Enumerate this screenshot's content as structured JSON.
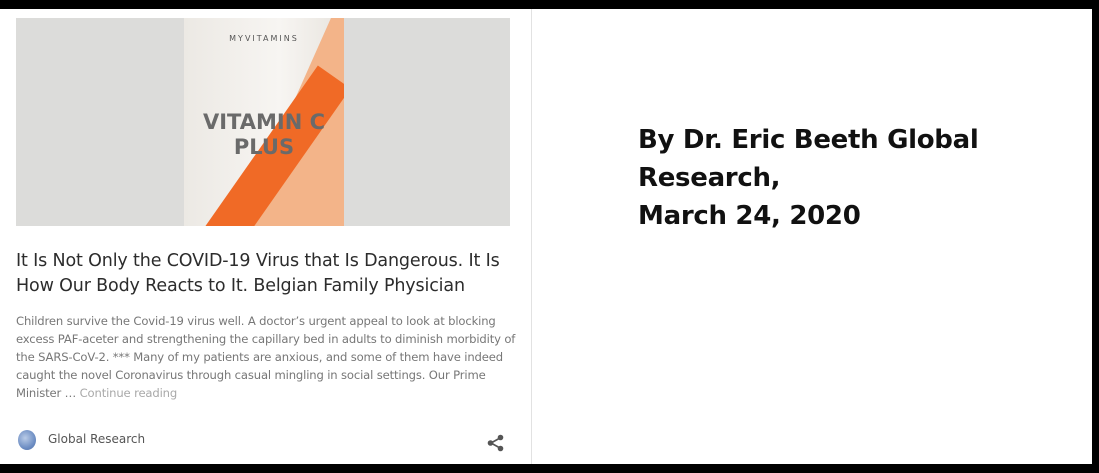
{
  "card": {
    "image": {
      "brand_text": "MYVITAMINS",
      "product_line1": "VITAMIN C",
      "product_line2": "PLUS",
      "accent_color": "#f06a26",
      "panel_color": "#f3b489"
    },
    "title": "It Is Not Only the COVID-19 Virus that Is Dangerous. It Is How Our Body Reacts to It. Belgian Family Physician",
    "excerpt": "Children survive the Covid-19 virus well. A doctor’s urgent appeal to look at blocking excess PAF-aceter and strengthening the capillary bed in adults to diminish morbidity of the SARS-CoV-2. *** Many of my patients are anxious, and some of them have indeed caught the novel Coronavirus through casual mingling in social settings. Our Prime Minister …",
    "continue_label": "Continue reading",
    "source_name": "Global Research",
    "source_icon": "globe-logo-icon",
    "share_icon": "share-icon"
  },
  "byline": {
    "text": " By Dr. Eric Beeth Global\nResearch,\nMarch 24, 2020"
  }
}
